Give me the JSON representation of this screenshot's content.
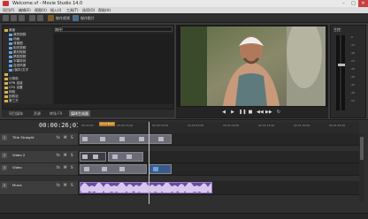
{
  "window": {
    "title": "Welcome.vf - Movie Studio 14.0",
    "min": "–",
    "max": "□",
    "close": "✕"
  },
  "menu": {
    "items": [
      "项目(F)",
      "编辑(E)",
      "视图(V)",
      "插入(I)",
      "工具(T)",
      "选项(O)",
      "帮助(H)"
    ]
  },
  "toolbar": {
    "btn_a_label": "制作视频",
    "btn_b_label": "制作影片"
  },
  "explorer": {
    "path_label": "路径:",
    "tree": [
      {
        "label": "桌面",
        "indent": 0,
        "color": "yellow"
      },
      {
        "label": "我的视频",
        "indent": 1,
        "color": "blue"
      },
      {
        "label": "动画",
        "indent": 1,
        "color": "blue"
      },
      {
        "label": "背景图",
        "indent": 1,
        "color": "blue"
      },
      {
        "label": "相关视频",
        "indent": 1,
        "color": "blue"
      },
      {
        "label": "素材视频",
        "indent": 1,
        "color": "blue"
      },
      {
        "label": "搞笑视频",
        "indent": 1,
        "color": "blue"
      },
      {
        "label": "字幕特效",
        "indent": 1,
        "color": "blue"
      },
      {
        "label": "自然风景",
        "indent": 1,
        "color": "blue"
      },
      {
        "label": "(保存)文字",
        "indent": 1,
        "color": "blue"
      },
      {
        "label": "",
        "indent": 0,
        "color": "yellow"
      },
      {
        "label": "计算机",
        "indent": 0,
        "color": "yellow"
      },
      {
        "label": "VPN 连接",
        "indent": 0,
        "color": "yellow"
      },
      {
        "label": "CPU 设置",
        "indent": 0,
        "color": "yellow"
      },
      {
        "label": "网络",
        "indent": 0,
        "color": "yellow"
      },
      {
        "label": "回收站",
        "indent": 0,
        "color": "yellow"
      },
      {
        "label": "第三方",
        "indent": 0,
        "color": "yellow"
      }
    ],
    "tabs": [
      "项目媒体",
      "资源",
      "转场 FX",
      "媒体生成器"
    ],
    "active_tab": 3
  },
  "preview": {
    "controls": [
      "◀",
      "▶",
      "❚❚",
      "■",
      "◀◀",
      "▶▶",
      "↻"
    ]
  },
  "mixer": {
    "title": "主控",
    "scale": [
      "-6",
      "-12",
      "-18",
      "-24",
      "-30",
      "-36",
      "-42",
      "-48",
      "-54"
    ]
  },
  "timeline": {
    "timecode": "00:00:26;01",
    "marker_label": "Good Beat",
    "ruler_ticks": [
      "00:00:00",
      "00:00:15;00",
      "00:00:30;00",
      "00:00:45;00",
      "00:01:00;00",
      "00:01:15;00",
      "00:01:30;00",
      "00:01:45;00"
    ],
    "tracks": [
      {
        "num": "1",
        "name": "Title Straight",
        "fx": "fx",
        "m": "M",
        "s": "S"
      },
      {
        "num": "2",
        "name": "Video 2",
        "fx": "fx",
        "m": "M",
        "s": "S"
      },
      {
        "num": "3",
        "name": "Video",
        "fx": "fx",
        "m": "M",
        "s": "S"
      },
      {
        "num": "4",
        "name": "Music",
        "fx": "fx",
        "m": "M",
        "s": "S"
      }
    ]
  },
  "status": {
    "text": ""
  },
  "colors": {
    "accent": "#c07a20",
    "clip_video": "#6b6b78",
    "clip_audio": "#6a4a9a"
  }
}
